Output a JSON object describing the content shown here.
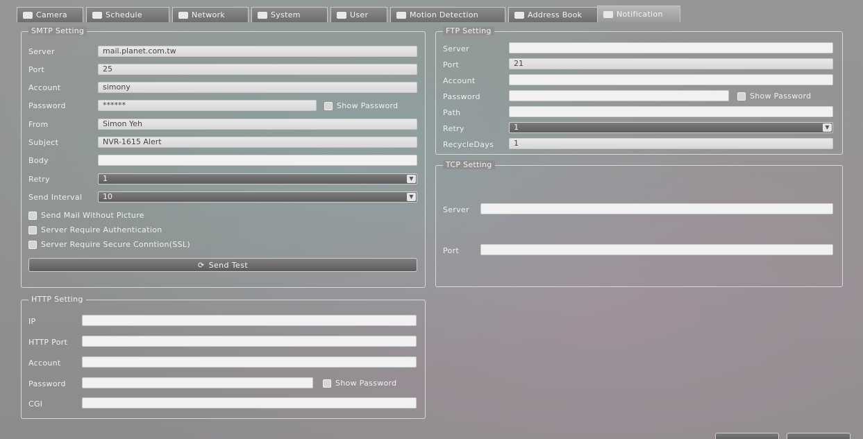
{
  "tabs": [
    {
      "label": "Camera",
      "icon": "camera-icon"
    },
    {
      "label": "Schedule",
      "icon": "schedule-icon"
    },
    {
      "label": "Network",
      "icon": "network-icon"
    },
    {
      "label": "System",
      "icon": "system-icon"
    },
    {
      "label": "User",
      "icon": "user-icon"
    },
    {
      "label": "Motion Detection",
      "icon": "motion-icon"
    },
    {
      "label": "Address Book",
      "icon": "address-book-icon"
    },
    {
      "label": "Notification",
      "icon": "notification-icon"
    }
  ],
  "smtp": {
    "title": "SMTP Setting",
    "server_label": "Server",
    "server_value": "mail.planet.com.tw",
    "port_label": "Port",
    "port_value": "25",
    "account_label": "Account",
    "account_value": "simony",
    "password_label": "Password",
    "password_value": "******",
    "show_password": "Show Password",
    "from_label": "From",
    "from_value": "Simon Yeh",
    "subject_label": "Subject",
    "subject_value": "NVR-1615 Alert",
    "body_label": "Body",
    "body_value": "",
    "retry_label": "Retry",
    "retry_value": "1",
    "interval_label": "Send Interval",
    "interval_value": "10",
    "opt_no_picture": "Send Mail Without Picture",
    "opt_auth": "Server Require Authentication",
    "opt_ssl": "Server Require Secure Conntion(SSL)",
    "send_test": "Send Test"
  },
  "ftp": {
    "title": "FTP Setting",
    "server_label": "Server",
    "server_value": "",
    "port_label": "Port",
    "port_value": "21",
    "account_label": "Account",
    "account_value": "",
    "password_label": "Password",
    "password_value": "",
    "show_password": "Show Password",
    "path_label": "Path",
    "path_value": "",
    "retry_label": "Retry",
    "retry_value": "1",
    "recycle_label": "RecycleDays",
    "recycle_value": "1"
  },
  "tcp": {
    "title": "TCP Setting",
    "server_label": "Server",
    "server_value": "",
    "port_label": "Port",
    "port_value": ""
  },
  "http": {
    "title": "HTTP Setting",
    "ip_label": "IP",
    "ip_value": "",
    "port_label": "HTTP Port",
    "port_value": "",
    "account_label": "Account",
    "account_value": "",
    "password_label": "Password",
    "password_value": "",
    "show_password": "Show Password",
    "cgi_label": "CGI",
    "cgi_value": ""
  }
}
